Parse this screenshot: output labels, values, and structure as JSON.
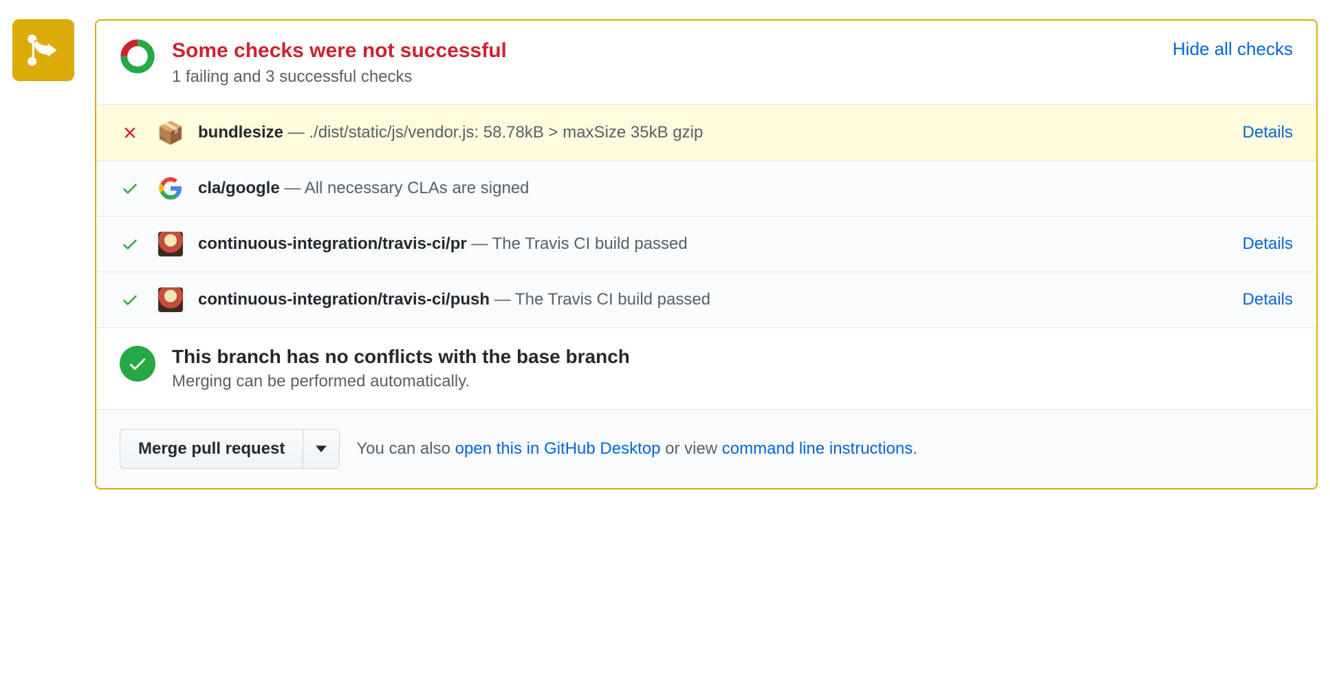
{
  "header": {
    "title": "Some checks were not successful",
    "subtitle": "1 failing and 3 successful checks",
    "hide_all": "Hide all checks"
  },
  "checks": [
    {
      "status": "fail",
      "icon": "package",
      "name": "bundlesize",
      "desc": "./dist/static/js/vendor.js: 58.78kB > maxSize 35kB gzip",
      "details": "Details"
    },
    {
      "status": "pass",
      "icon": "google",
      "name": "cla/google",
      "desc": "All necessary CLAs are signed",
      "details": ""
    },
    {
      "status": "pass",
      "icon": "travis",
      "name": "continuous-integration/travis-ci/pr",
      "desc": "The Travis CI build passed",
      "details": "Details"
    },
    {
      "status": "pass",
      "icon": "travis",
      "name": "continuous-integration/travis-ci/push",
      "desc": "The Travis CI build passed",
      "details": "Details"
    }
  ],
  "merge_status": {
    "heading": "This branch has no conflicts with the base branch",
    "sub": "Merging can be performed automatically."
  },
  "actions": {
    "merge_button": "Merge pull request",
    "hint_prefix": "You can also ",
    "open_desktop": "open this in GitHub Desktop",
    "hint_middle": " or view ",
    "cli_instructions": "command line instructions",
    "hint_suffix": "."
  }
}
